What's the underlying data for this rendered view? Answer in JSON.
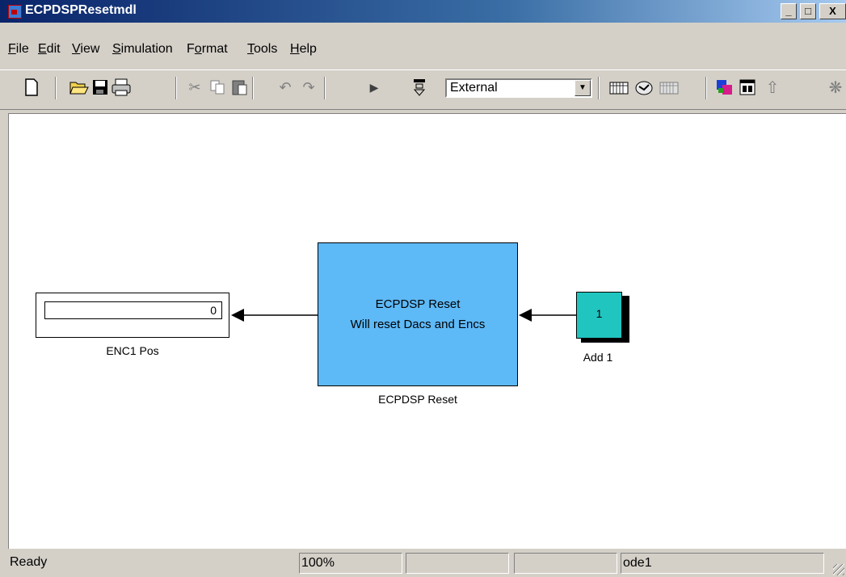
{
  "window": {
    "title": "ECPDSPResetmdl",
    "controls": {
      "minimize": "_",
      "maximize": "□",
      "close": "X"
    }
  },
  "menu": [
    {
      "label": "File",
      "key": "F",
      "rest": "ile"
    },
    {
      "label": "Edit",
      "key": "E",
      "rest": "dit"
    },
    {
      "label": "View",
      "key": "V",
      "rest": "iew"
    },
    {
      "label": "Simulation",
      "key": "S",
      "rest": "imulation"
    },
    {
      "label": "Format",
      "pre": "F",
      "key": "o",
      "rest": "rmat"
    },
    {
      "label": "Tools",
      "key": "T",
      "rest": "ools"
    },
    {
      "label": "Help",
      "key": "H",
      "rest": "elp"
    }
  ],
  "toolbar": {
    "icons": [
      "new-icon",
      "open-icon",
      "save-icon",
      "print-icon",
      "cut-icon",
      "copy-icon",
      "paste-icon",
      "undo-icon",
      "redo-icon",
      "play-icon",
      "stop-icon",
      "library-icon",
      "build-icon",
      "debug-icon",
      "model-explorer-icon",
      "browser-icon",
      "up-icon",
      "settings-icon"
    ],
    "simulation_mode": "External"
  },
  "diagram": {
    "display_block": {
      "value": "0",
      "label": "ENC1 Pos"
    },
    "subsystem_block": {
      "text_line1": "ECPDSP Reset",
      "text_line2": "Will reset Dacs and Encs",
      "label": "ECPDSP Reset",
      "color": "#5eb9f7"
    },
    "constant_block": {
      "value": "1",
      "label": "Add 1",
      "color": "#21c5c0"
    }
  },
  "status": {
    "state": "Ready",
    "zoom": "100%",
    "field3": "",
    "field4": "",
    "solver": "ode1"
  }
}
